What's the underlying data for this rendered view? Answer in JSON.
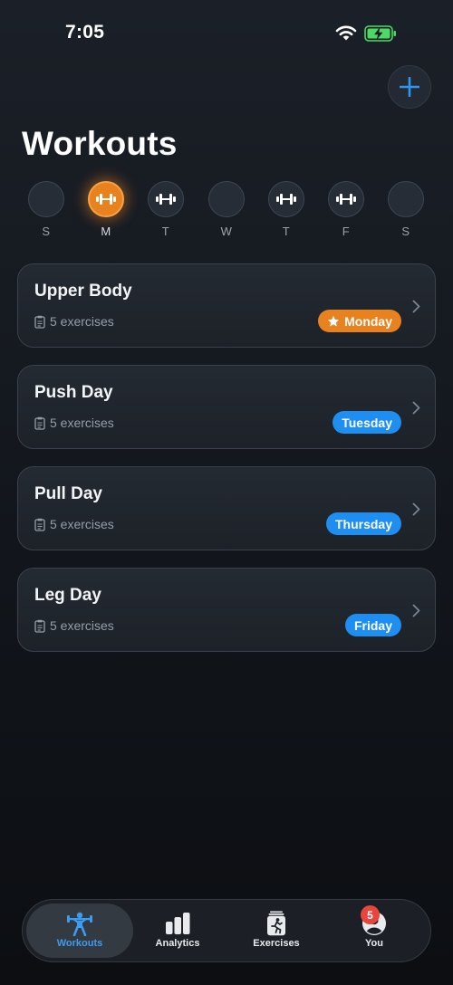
{
  "status": {
    "time": "7:05"
  },
  "header": {
    "title": "Workouts",
    "add_icon": "plus-icon"
  },
  "week": [
    {
      "letter": "S",
      "active": false,
      "has_workout": false
    },
    {
      "letter": "M",
      "active": true,
      "has_workout": true
    },
    {
      "letter": "T",
      "active": false,
      "has_workout": true
    },
    {
      "letter": "W",
      "active": false,
      "has_workout": false
    },
    {
      "letter": "T",
      "active": false,
      "has_workout": true
    },
    {
      "letter": "F",
      "active": false,
      "has_workout": true
    },
    {
      "letter": "S",
      "active": false,
      "has_workout": false
    }
  ],
  "workouts": [
    {
      "title": "Upper Body",
      "meta": "5 exercises",
      "day": "Monday",
      "starred": true,
      "badge_color": "#e8821e"
    },
    {
      "title": "Push Day",
      "meta": "5 exercises",
      "day": "Tuesday",
      "starred": false,
      "badge_color": "#1e8ff0"
    },
    {
      "title": "Pull Day",
      "meta": "5 exercises",
      "day": "Thursday",
      "starred": false,
      "badge_color": "#1e8ff0"
    },
    {
      "title": "Leg Day",
      "meta": "5 exercises",
      "day": "Friday",
      "starred": false,
      "badge_color": "#1e8ff0"
    }
  ],
  "tabs": [
    {
      "label": "Workouts",
      "icon": "weightlifter-icon",
      "active": true
    },
    {
      "label": "Analytics",
      "icon": "bar-chart-icon",
      "active": false
    },
    {
      "label": "Exercises",
      "icon": "exercise-card-icon",
      "active": false
    },
    {
      "label": "You",
      "icon": "profile-icon",
      "active": false
    }
  ],
  "you_badge_count": "5",
  "colors": {
    "accent_orange": "#e8821e",
    "accent_blue": "#1e8ff0",
    "badge_red": "#e8453c",
    "active_tab": "#3a9cf2"
  }
}
